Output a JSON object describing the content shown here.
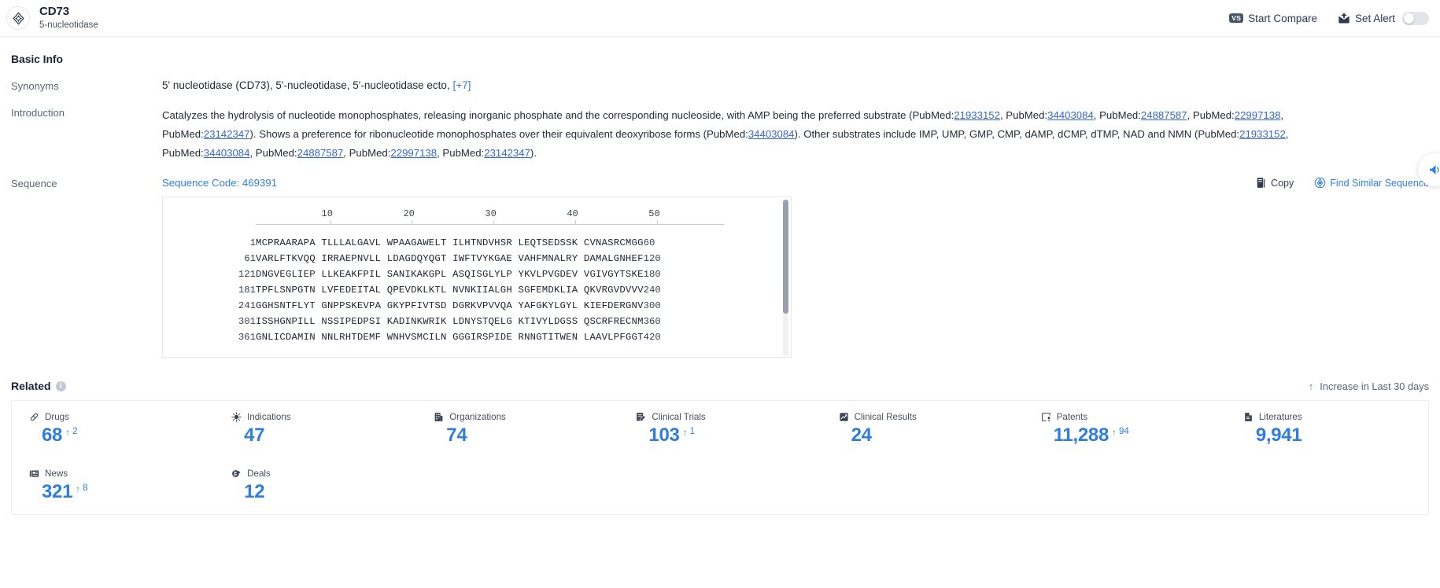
{
  "header": {
    "logo_icon": "target-crosshair-icon",
    "title": "CD73",
    "subtitle": "5-nucleotidase",
    "compare_badge": "VS",
    "compare_label": "Start Compare",
    "alert_icon": "mail-alert-icon",
    "alert_label": "Set Alert",
    "alert_toggle_state": "off"
  },
  "basic_info": {
    "section_title": "Basic Info",
    "synonyms": {
      "label": "Synonyms",
      "value": "5' nucleotidase (CD73),  5'-nucleotidase,  5'-nucleotidase ecto,",
      "more": "[+7]"
    },
    "introduction": {
      "label": "Introduction",
      "parts": [
        {
          "t": "text",
          "v": "Catalyzes the hydrolysis of nucleotide monophosphates, releasing inorganic phosphate and the corresponding nucleoside, with AMP being the preferred substrate (PubMed:"
        },
        {
          "t": "link",
          "v": "21933152"
        },
        {
          "t": "text",
          "v": ", PubMed:"
        },
        {
          "t": "link",
          "v": "34403084"
        },
        {
          "t": "text",
          "v": ", PubMed:"
        },
        {
          "t": "link",
          "v": "24887587"
        },
        {
          "t": "text",
          "v": ", PubMed:"
        },
        {
          "t": "link",
          "v": "22997138"
        },
        {
          "t": "text",
          "v": ", PubMed:"
        },
        {
          "t": "link",
          "v": "23142347"
        },
        {
          "t": "text",
          "v": "). Shows a preference for ribonucleotide monophosphates over their equivalent deoxyribose forms (PubMed:"
        },
        {
          "t": "link",
          "v": "34403084"
        },
        {
          "t": "text",
          "v": "). Other substrates include IMP, UMP, GMP, CMP, dAMP, dCMP, dTMP, NAD and NMN (PubMed:"
        },
        {
          "t": "link",
          "v": "21933152"
        },
        {
          "t": "text",
          "v": ", PubMed:"
        },
        {
          "t": "link",
          "v": "34403084"
        },
        {
          "t": "text",
          "v": ", PubMed:"
        },
        {
          "t": "link",
          "v": "24887587"
        },
        {
          "t": "text",
          "v": ", PubMed:"
        },
        {
          "t": "link",
          "v": "22997138"
        },
        {
          "t": "text",
          "v": ", PubMed:"
        },
        {
          "t": "link",
          "v": "23142347"
        },
        {
          "t": "text",
          "v": ")."
        }
      ]
    }
  },
  "sequence": {
    "label": "Sequence",
    "code_label": "Sequence Code: 469391",
    "copy_label": "Copy",
    "copy_icon": "copy-icon",
    "find_label": "Find Similar Sequence",
    "find_icon": "find-similar-icon",
    "ruler_ticks": [
      10,
      20,
      30,
      40,
      50
    ],
    "rows": [
      {
        "start": "1",
        "residues": "MCPRAARAPA TLLLALGAVL WPAAGAWELT ILHTNDVHSR LEQTSEDSSK CVNASRCMGG",
        "end": "60"
      },
      {
        "start": "61",
        "residues": "VARLFTKVQQ IRRAEPNVLL LDAGDQYQGT IWFTVYKGAE VAHFMNALRY DAMALGNHEF",
        "end": "120"
      },
      {
        "start": "121",
        "residues": "DNGVEGLIEP LLKEAKFPIL SANIKAKGPL ASQISGLYLP YKVLPVGDEV VGIVGYTSKE",
        "end": "180"
      },
      {
        "start": "181",
        "residues": "TPFLSNPGTN LVFEDEITAL QPEVDKLKTL NVNKIIALGH SGFEMDKLIA QKVRGVDVVV",
        "end": "240"
      },
      {
        "start": "241",
        "residues": "GGHSNTFLYT GNPPSKEVPA GKYPFIVTSD DGRKVPVVQA YAFGKYLGYL KIEFDERGNV",
        "end": "300"
      },
      {
        "start": "301",
        "residues": "ISSHGNPILL NSSIPEDPSI KADINKWRIK LDNYSTQELG KTIVYLDGSS QSCRFRECNM",
        "end": "360"
      },
      {
        "start": "361",
        "residues": "GNLICDAMIN NNLRHTDEMF WNHVSMCILN GGGIRSPIDE RNNGTITWEN LAAVLPFGGT",
        "end": "420"
      }
    ]
  },
  "related": {
    "title": "Related",
    "info_icon": "info-icon",
    "increase_note": "Increase in Last 30 days",
    "increase_arrow_color": "#3c9e4e",
    "accent_color": "#2f7de1",
    "cards": [
      {
        "label": "Drugs",
        "icon": "pill-icon",
        "value": "68",
        "delta": "2"
      },
      {
        "label": "Indications",
        "icon": "virus-icon",
        "value": "47",
        "delta": ""
      },
      {
        "label": "Organizations",
        "icon": "building-icon",
        "value": "74",
        "delta": ""
      },
      {
        "label": "Clinical Trials",
        "icon": "clinical-trial-icon",
        "value": "103",
        "delta": "1"
      },
      {
        "label": "Clinical Results",
        "icon": "clinical-result-icon",
        "value": "24",
        "delta": ""
      },
      {
        "label": "Patents",
        "icon": "patent-icon",
        "value": "11,288",
        "delta": "94"
      },
      {
        "label": "Literatures",
        "icon": "document-icon",
        "value": "9,941",
        "delta": ""
      },
      {
        "label": "News",
        "icon": "news-icon",
        "value": "321",
        "delta": "8"
      },
      {
        "label": "Deals",
        "icon": "deal-icon",
        "value": "12",
        "delta": ""
      }
    ]
  },
  "float_button": {
    "icon": "feedback-icon"
  }
}
